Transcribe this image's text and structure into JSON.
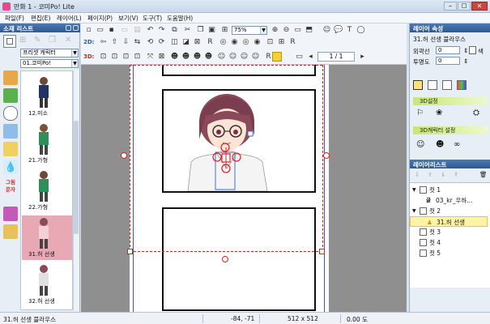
{
  "window": {
    "title": "만화 1 - 코미Po! Lite"
  },
  "menu": [
    "파일(F)",
    "편집(E)",
    "레이어(L)",
    "페이지(P)",
    "보기(V)",
    "도구(T)",
    "도움말(H)"
  ],
  "left_panel": {
    "header": "소재 리스트",
    "preset_combo": "프리셋 캐릭터",
    "char_combo": "01.코미Po!",
    "category_labels": [
      "그림",
      "문자"
    ],
    "thumbnails": [
      "12.미소",
      "21.가형",
      "22.가형",
      "31.허 선생",
      "32.허 선생"
    ],
    "selected_thumbnail": "31.허 선생"
  },
  "toolbar": {
    "row2_label": "2D:",
    "row3_label": "3D:",
    "zoom": "75%",
    "page_indicator": "1 / 1",
    "r_glyph": "R"
  },
  "right_panel": {
    "layer_props_header": "레이어 속성",
    "layer_name": "31.허 선생 블라우스",
    "outline_label": "외곽선",
    "outline_value": "0",
    "color_label": "색",
    "opacity_label": "투명도",
    "opacity_value": "0",
    "setting_3d": "3D설정",
    "setting_char": "3D캐릭터 설정",
    "layer_list_header": "레이어리스트",
    "layers": [
      {
        "label": "컷 1",
        "indent": 0
      },
      {
        "label": "03_kr_우하...",
        "indent": 1
      },
      {
        "label": "컷 2",
        "indent": 0
      },
      {
        "label": "31.허 선생",
        "indent": 1
      },
      {
        "label": "컷 3",
        "indent": 0
      },
      {
        "label": "컷 4",
        "indent": 0
      },
      {
        "label": "컷 5",
        "indent": 0
      }
    ]
  },
  "status": {
    "item_name": "31.허 선생 블라우스",
    "coords": "-84, -71",
    "size": "512 x 512",
    "angle": "0.00 도"
  },
  "colors": {
    "header_blue": "#2e5a94",
    "selection_red": "#e02020",
    "selected_layer": "#fff3a6",
    "highlight_pink": "#e8a9b5"
  }
}
